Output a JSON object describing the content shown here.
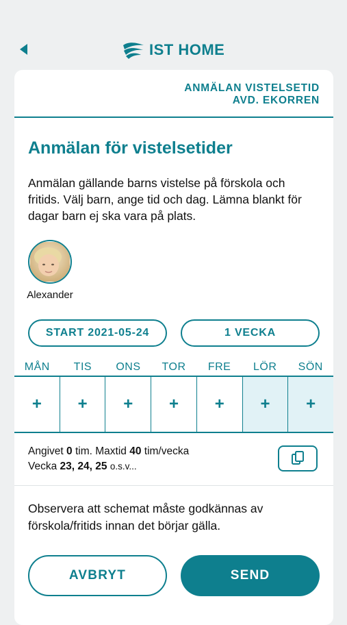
{
  "header": {
    "logo_text": "IST HOME",
    "brand_color": "#0e7f8e"
  },
  "card": {
    "heading_line1": "ANMÄLAN VISTELSETID",
    "heading_line2": "AVD. EKORREN",
    "title": "Anmälan för vistelsetider",
    "description": "Anmälan gällande barns vistelse på förskola och fritids. Välj barn, ange tid och dag. Lämna blankt för dagar barn ej ska vara på plats."
  },
  "child": {
    "name": "Alexander"
  },
  "controls": {
    "start_label": "START 2021-05-24",
    "week_label": "1 VECKA"
  },
  "days": [
    {
      "label": "MÅN",
      "value": "+",
      "weekend": false
    },
    {
      "label": "TIS",
      "value": "+",
      "weekend": false
    },
    {
      "label": "ONS",
      "value": "+",
      "weekend": false
    },
    {
      "label": "TOR",
      "value": "+",
      "weekend": false
    },
    {
      "label": "FRE",
      "value": "+",
      "weekend": false
    },
    {
      "label": "LÖR",
      "value": "+",
      "weekend": true
    },
    {
      "label": "SÖN",
      "value": "+",
      "weekend": true
    }
  ],
  "summary": {
    "entered_prefix": "Angivet",
    "entered_value": "0",
    "entered_unit": "tim. Maxtid",
    "max_value": "40",
    "max_unit": "tim/vecka",
    "week_prefix": "Vecka",
    "weeks": "23, 24, 25",
    "weeks_suffix": "o.s.v..."
  },
  "notice": "Observera att schemat måste godkännas av förskola/fritids innan det börjar gälla.",
  "actions": {
    "cancel_label": "AVBRYT",
    "send_label": "SEND"
  },
  "icons": {
    "back": "back-arrow-icon",
    "logo": "ist-logo-icon",
    "copy": "copy-icon"
  }
}
